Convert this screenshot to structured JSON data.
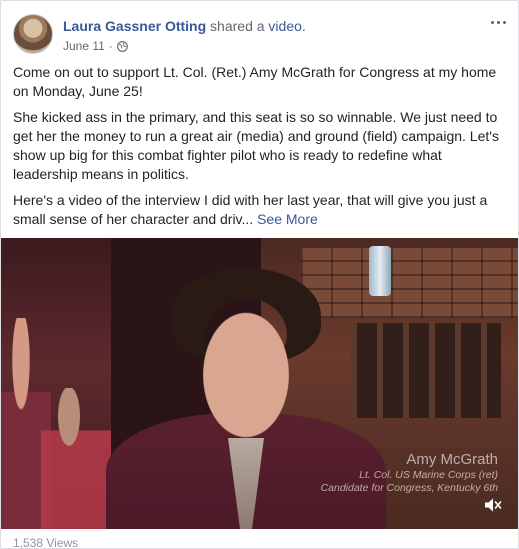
{
  "post": {
    "author": "Laura Gassner Otting",
    "shared_text": "shared a",
    "shared_link": "video.",
    "date": "June 11",
    "date_separator": "·",
    "paragraphs": [
      "Come on out to support Lt. Col. (Ret.) Amy McGrath for Congress at my home on Monday, June 25!",
      "She kicked ass in the primary, and this seat is so so winnable. We just need to get her the money to run a great air (media) and ground (field) campaign. Let's show up big for this combat fighter pilot who is ready to redefine what leadership means in politics."
    ],
    "truncated_text": "Here's a video of the interview I did with her last year, that will give you just a small sense of her character and driv...",
    "see_more": "See More"
  },
  "video": {
    "name": "Amy McGrath",
    "title_line": "Lt. Col. US Marine Corps (ret)",
    "subtitle_line": "Candidate for Congress, Kentucky 6th",
    "views": "1,538 Views"
  },
  "colors": {
    "link": "#385898",
    "meta": "#616770"
  },
  "icons": [
    "globe-icon",
    "more-options-icon",
    "muted-speaker-icon"
  ]
}
